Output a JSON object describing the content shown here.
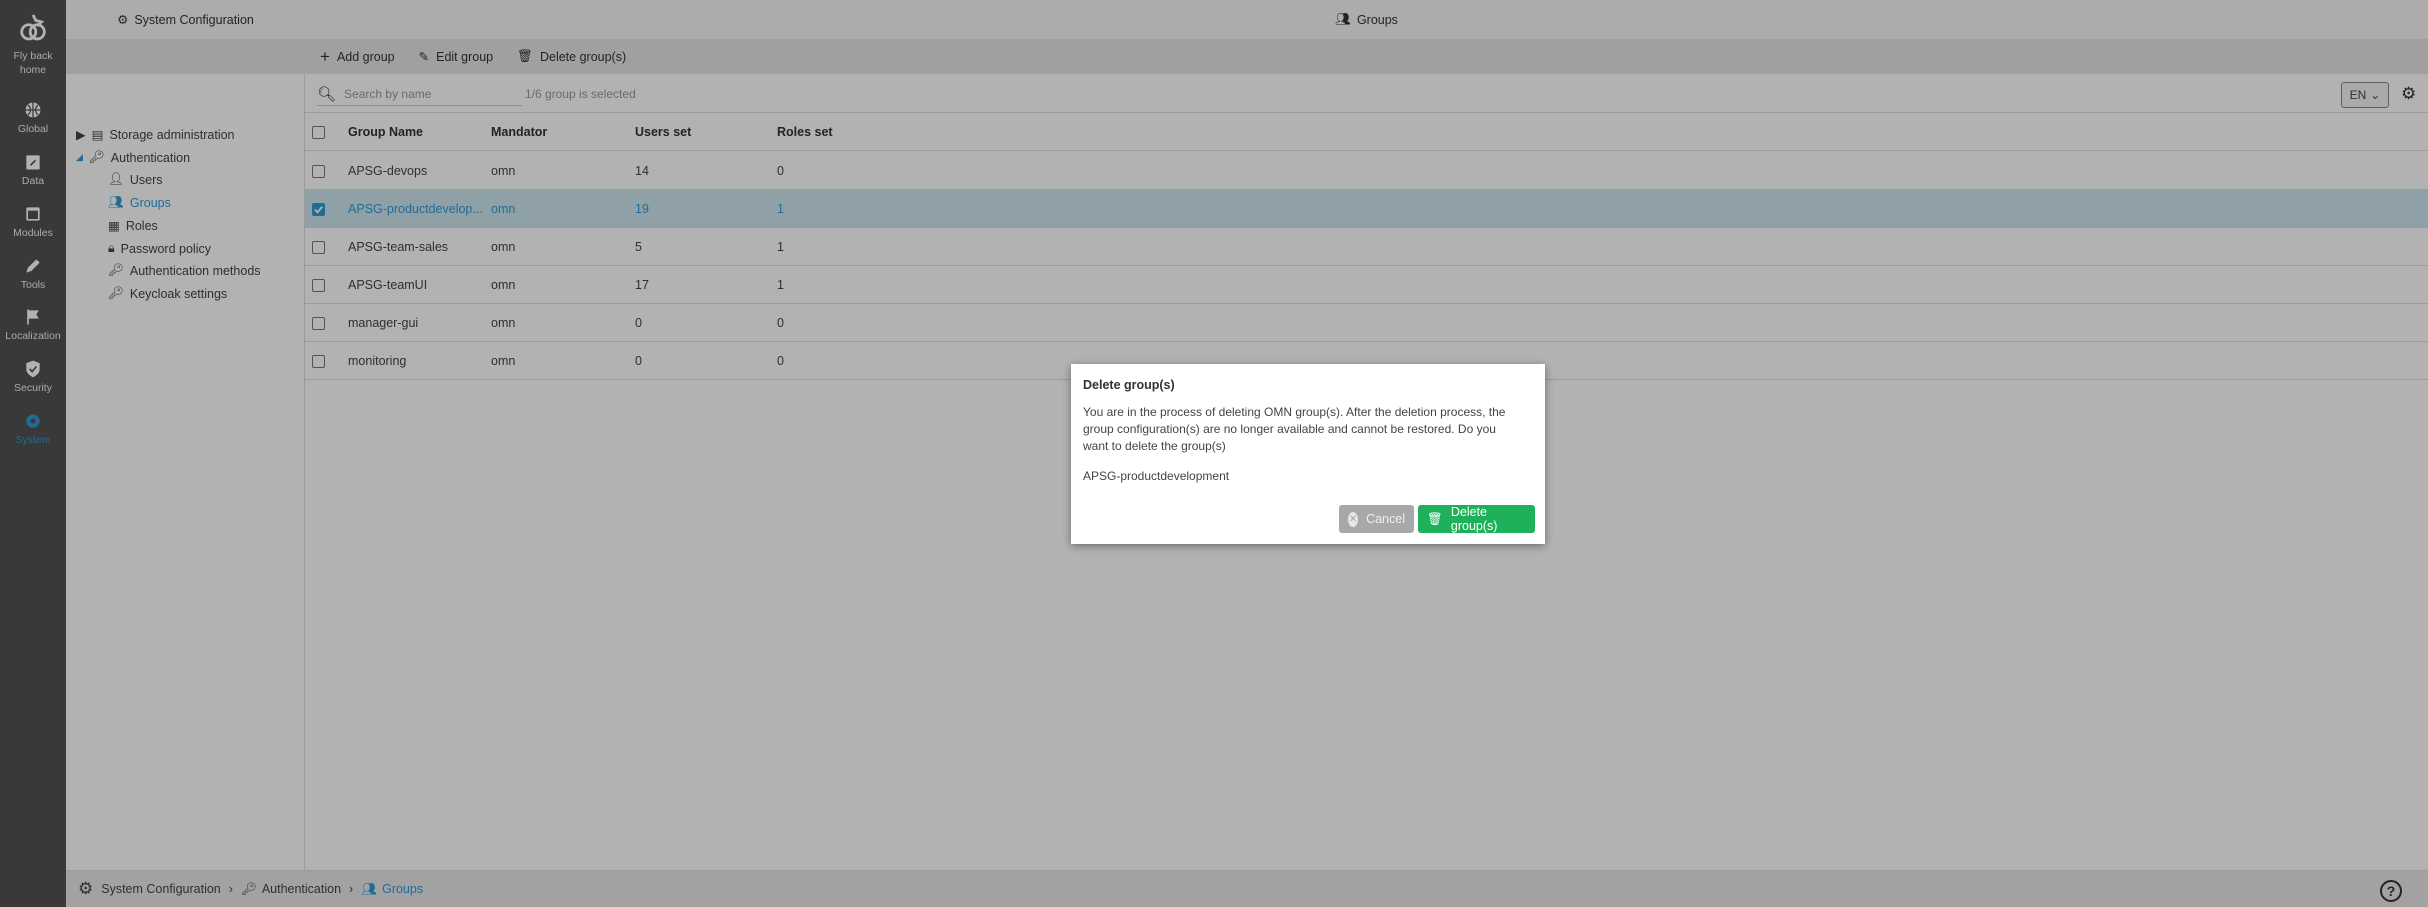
{
  "rail": {
    "home": "Fly back home",
    "items": [
      {
        "label": "Global",
        "icon": "globe-icon"
      },
      {
        "label": "Data",
        "icon": "calendar-edit-icon"
      },
      {
        "label": "Modules",
        "icon": "window-icon"
      },
      {
        "label": "Tools",
        "icon": "pencil-icon"
      },
      {
        "label": "Localization",
        "icon": "flag-icon"
      },
      {
        "label": "Security",
        "icon": "shield-check-icon"
      },
      {
        "label": "System",
        "icon": "gear-wrench-icon",
        "active": true
      }
    ]
  },
  "tree": {
    "title": "System Configuration",
    "nodes": [
      {
        "label": "Storage administration",
        "level": 0,
        "expanded": false
      },
      {
        "label": "Authentication",
        "level": 0,
        "expanded": true
      },
      {
        "label": "Users",
        "level": 1
      },
      {
        "label": "Groups",
        "level": 1,
        "selected": true
      },
      {
        "label": "Roles",
        "level": 1
      },
      {
        "label": "Password policy",
        "level": 1
      },
      {
        "label": "Authentication methods",
        "level": 1
      },
      {
        "label": "Keycloak settings",
        "level": 1
      }
    ]
  },
  "main": {
    "title": "Groups",
    "toolbar": {
      "add": "Add group",
      "edit": "Edit group",
      "delete": "Delete group(s)"
    },
    "search": {
      "placeholder": "Search by name",
      "value": ""
    },
    "selection": "1/6 group is selected",
    "language": "EN",
    "table": {
      "columns": [
        "Group Name",
        "Mandator",
        "Users set",
        "Roles set"
      ],
      "rows": [
        {
          "name": "APSG-devops",
          "mandator": "omn",
          "users": "14",
          "roles": "0",
          "checked": false
        },
        {
          "name": "APSG-productdevelop...",
          "mandator": "omn",
          "users": "19",
          "roles": "1",
          "checked": true
        },
        {
          "name": "APSG-team-sales",
          "mandator": "omn",
          "users": "5",
          "roles": "1",
          "checked": false
        },
        {
          "name": "APSG-teamUI",
          "mandator": "omn",
          "users": "17",
          "roles": "1",
          "checked": false
        },
        {
          "name": "manager-gui",
          "mandator": "omn",
          "users": "0",
          "roles": "0",
          "checked": false
        },
        {
          "name": "monitoring",
          "mandator": "omn",
          "users": "0",
          "roles": "0",
          "checked": false
        }
      ]
    }
  },
  "breadcrumb": [
    "System Configuration",
    "Authentication",
    "Groups"
  ],
  "help": "?",
  "dialog": {
    "title": "Delete group(s)",
    "message": "You are in the process of deleting OMN group(s). After the deletion process, the group configuration(s) are no longer available and cannot be restored. Do you want to delete the group(s)",
    "item": "APSG-productdevelopment",
    "cancel": "Cancel",
    "confirm": "Delete group(s)"
  },
  "colors": {
    "accent": "#2f9bd6",
    "confirm": "#1fb15a",
    "rail": "#525252"
  }
}
